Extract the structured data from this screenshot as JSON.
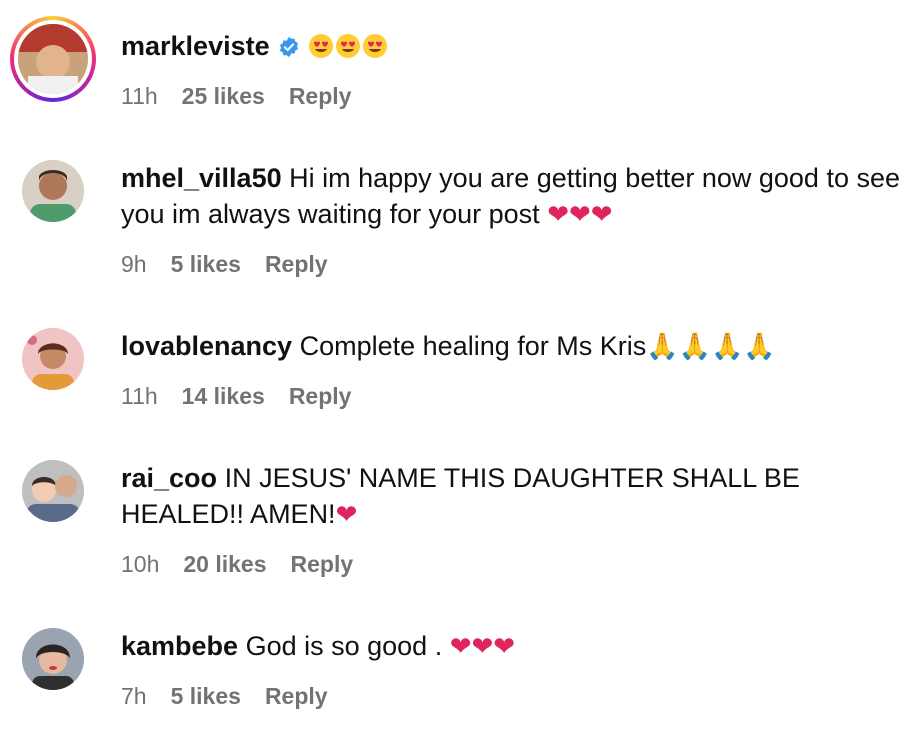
{
  "comments": [
    {
      "username": "markleviste",
      "verified": true,
      "text": "",
      "emoji_icons": [
        "heart-eyes-emoji-icon",
        "heart-eyes-emoji-icon",
        "heart-eyes-emoji-icon"
      ],
      "time": "11h",
      "likes": "25 likes",
      "reply": "Reply"
    },
    {
      "username": "mhel_villa50",
      "text": "Hi im happy you are getting better now good to see you im always waiting for your post",
      "emoji": "❤❤❤",
      "time": "9h",
      "likes": "5 likes",
      "reply": "Reply"
    },
    {
      "username": "lovablenancy",
      "text": "Complete healing for Ms Kris",
      "emoji": "🙏🙏🙏🙏",
      "time": "11h",
      "likes": "14 likes",
      "reply": "Reply"
    },
    {
      "username": "rai_coo",
      "text": "IN JESUS' NAME THIS DAUGHTER SHALL BE HEALED!! AMEN!",
      "emoji": "❤",
      "time": "10h",
      "likes": "20 likes",
      "reply": "Reply"
    },
    {
      "username": "kambebe",
      "text": "God is so good .",
      "emoji": "❤❤❤",
      "time": "7h",
      "likes": "5 likes",
      "reply": "Reply"
    }
  ],
  "colors": {
    "meta_text": "#737373",
    "verified_blue": "#3897f0",
    "heart_red": "#e0245e"
  }
}
